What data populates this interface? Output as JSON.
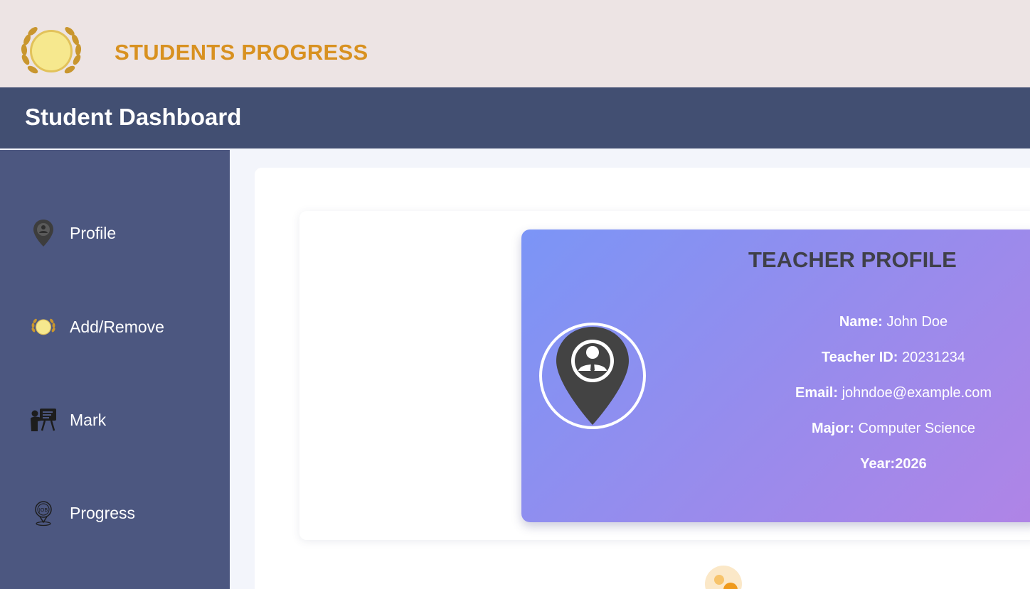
{
  "header": {
    "brand_title": "STUDENTS PROGRESS",
    "dashboard_title": "Student Dashboard"
  },
  "sidebar": {
    "items": [
      {
        "label": "Profile",
        "icon": "location-person-icon"
      },
      {
        "label": "Add/Remove",
        "icon": "laurel-medal-icon"
      },
      {
        "label": "Mark",
        "icon": "teacher-board-icon"
      },
      {
        "label": "Progress",
        "icon": "job-pin-icon"
      }
    ]
  },
  "profile": {
    "heading": "TEACHER PROFILE",
    "name_label": "Name:",
    "name_value": "John Doe",
    "id_label": "Teacher ID:",
    "id_value": "20231234",
    "email_label": "Email:",
    "email_value": "johndoe@example.com",
    "major_label": "Major:",
    "major_value": "Computer Science",
    "year_label": "Year:",
    "year_value": "2026"
  },
  "colors": {
    "banner_bg": "#ede4e4",
    "brand_text": "#d89120",
    "dash_bar": "#424f72",
    "sidebar_bg": "#4c5780",
    "card_gradient_start": "#7b95f6",
    "card_gradient_end": "#b084e6"
  }
}
